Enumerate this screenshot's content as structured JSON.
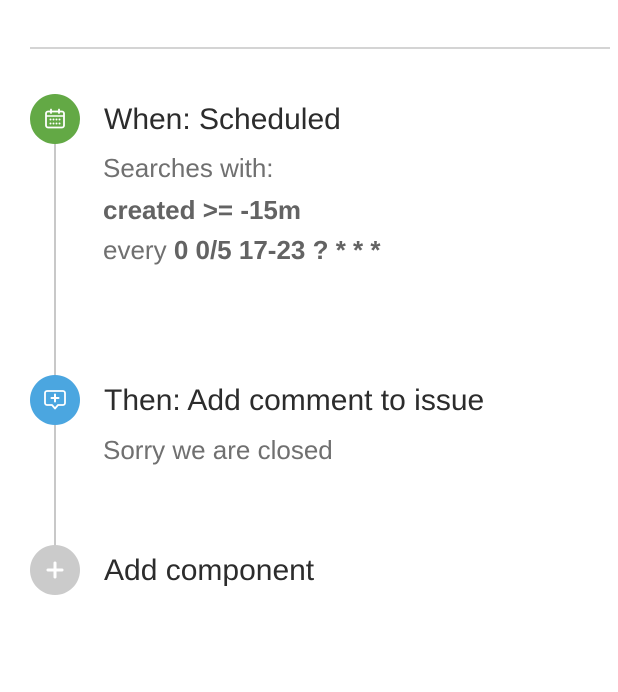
{
  "colors": {
    "trigger": "#63a945",
    "action": "#4ba6e0",
    "add": "#cbcbcb",
    "line": "#c8c8c8"
  },
  "trigger": {
    "icon": "calendar-icon",
    "title": "When: Scheduled",
    "searches_label": "Searches with:",
    "query": "created >= -15m",
    "every_label": "every",
    "cron": "0 0/5 17-23 ? * * *"
  },
  "action": {
    "icon": "comment-add-icon",
    "title": "Then: Add comment to issue",
    "comment": "Sorry we are closed"
  },
  "add_component": {
    "icon": "plus-icon",
    "label": "Add component"
  }
}
